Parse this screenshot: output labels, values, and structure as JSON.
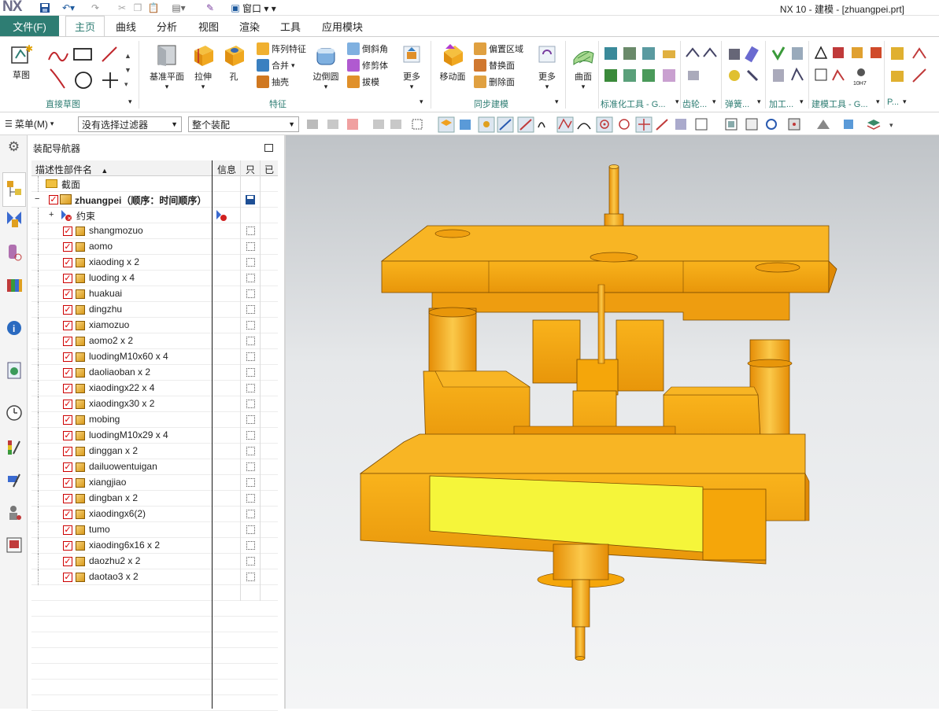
{
  "titlebar": {
    "logo": "NX",
    "window_menu": "窗口",
    "title": "NX 10 - 建模 - [zhuangpei.prt]"
  },
  "menubar": {
    "file": "文件(F)",
    "tabs": [
      "主页",
      "曲线",
      "分析",
      "视图",
      "渲染",
      "工具",
      "应用模块"
    ],
    "active_tab": "主页"
  },
  "ribbon": {
    "sketch": "草图",
    "direct_sketch_group": "直接草图",
    "datum_plane": "基准平面",
    "extrude": "拉伸",
    "hole": "孔",
    "pattern_feature": "阵列特征",
    "unite": "合并",
    "shell": "抽壳",
    "edge_blend": "边倒圆",
    "chamfer": "倒斜角",
    "trim_body": "修剪体",
    "draft": "拔模",
    "more1": "更多",
    "feature_group": "特征",
    "move_face": "移动面",
    "offset_region": "偏置区域",
    "replace_face": "替换面",
    "delete_face": "删除面",
    "more2": "更多",
    "sync_group": "同步建模",
    "surface": "曲面",
    "std_tools_group": "标准化工具 - G...",
    "gear_group": "齿轮...",
    "spring_group": "弹簧...",
    "machining_group": "加工...",
    "modeling_tools_group": "建模工具 - G...",
    "p_group": "P...",
    "tolerance_label": "10H7"
  },
  "cmdbar": {
    "menu": "菜单(M)",
    "filter": "没有选择过滤器",
    "scope": "整个装配"
  },
  "navigator": {
    "title": "装配导航器",
    "col_name": "描述性部件名",
    "col_info": "信息",
    "col_readonly": "只",
    "col_modified": "已",
    "section_row": "截面",
    "root_row": "zhuangpei（顺序：时间顺序）",
    "constraints_row": "约束",
    "parts": [
      "shangmozuo",
      "aomo",
      "xiaoding x 2",
      "luoding x 4",
      "huakuai",
      "dingzhu",
      "xiamozuo",
      "aomo2 x 2",
      "luodingM10x60 x 4",
      "daoliaoban x 2",
      "xiaodingx22 x 4",
      "xiaodingx30 x 2",
      "mobing",
      "luodingM10x29 x 4",
      "dinggan x 2",
      "dailuowentuigan",
      "xiangjiao",
      "dingban x 2",
      "xiaodingx6(2)",
      "tumo",
      "xiaoding6x16 x 2",
      "daozhu2 x 2",
      "daotao3 x 2"
    ]
  },
  "colors": {
    "accent": "#2e7d73",
    "model_orange": "#f5a60a",
    "model_highlight": "#f5f53a"
  }
}
